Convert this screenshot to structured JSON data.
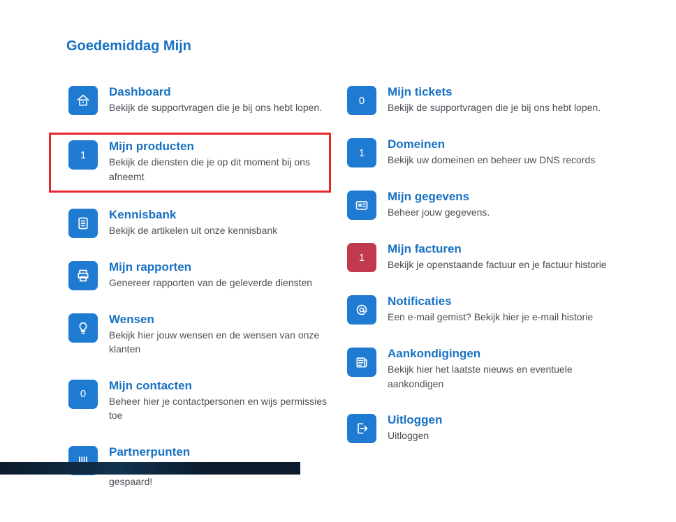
{
  "greeting": "Goedemiddag Mijn",
  "left": [
    {
      "badge_type": "icon",
      "icon": "home",
      "title": "Dashboard",
      "desc": "Bekijk de supportvragen die je bij ons hebt lopen.",
      "highlight": false
    },
    {
      "badge_type": "count",
      "count": "1",
      "title": "Mijn producten",
      "desc": "Bekijk de diensten die je op dit moment bij ons afneemt",
      "highlight": true
    },
    {
      "badge_type": "icon",
      "icon": "book",
      "title": "Kennisbank",
      "desc": "Bekijk de artikelen uit onze kennisbank",
      "highlight": false
    },
    {
      "badge_type": "icon",
      "icon": "printer",
      "title": "Mijn rapporten",
      "desc": "Genereer rapporten van de geleverde diensten",
      "highlight": false
    },
    {
      "badge_type": "icon",
      "icon": "bulb",
      "title": "Wensen",
      "desc": "Bekijk hier jouw wensen en de wensen van onze klanten",
      "highlight": false
    },
    {
      "badge_type": "count",
      "count": "0",
      "title": "Mijn contacten",
      "desc": "Beheer hier je contactpersonen en wijs permissies toe",
      "highlight": false
    },
    {
      "badge_type": "icon",
      "icon": "tally",
      "title": "Partnerpunten",
      "desc": "Bekijk hier hoeveel partnerpunten je al hebt gespaard!",
      "highlight": false
    }
  ],
  "right": [
    {
      "badge_type": "count",
      "count": "0",
      "title": "Mijn tickets",
      "desc": "Bekijk de supportvragen die je bij ons hebt lopen.",
      "highlight": false
    },
    {
      "badge_type": "count",
      "count": "1",
      "title": "Domeinen",
      "desc": "Bekijk uw domeinen en beheer uw DNS records",
      "highlight": false
    },
    {
      "badge_type": "icon",
      "icon": "idcard",
      "title": "Mijn gegevens",
      "desc": "Beheer jouw gegevens.",
      "highlight": false
    },
    {
      "badge_type": "count",
      "count": "1",
      "title": "Mijn facturen",
      "desc": "Bekijk je openstaande factuur en je factuur historie",
      "highlight": false,
      "danger": true
    },
    {
      "badge_type": "icon",
      "icon": "at",
      "title": "Notificaties",
      "desc": "Een e-mail gemist? Bekijk hier je e-mail historie",
      "highlight": false
    },
    {
      "badge_type": "icon",
      "icon": "news",
      "title": "Aankondigingen",
      "desc": "Bekijk hier het laatste nieuws en eventuele aankondigen",
      "highlight": false
    },
    {
      "badge_type": "icon",
      "icon": "logout",
      "title": "Uitloggen",
      "desc": "Uitloggen",
      "highlight": false
    }
  ]
}
